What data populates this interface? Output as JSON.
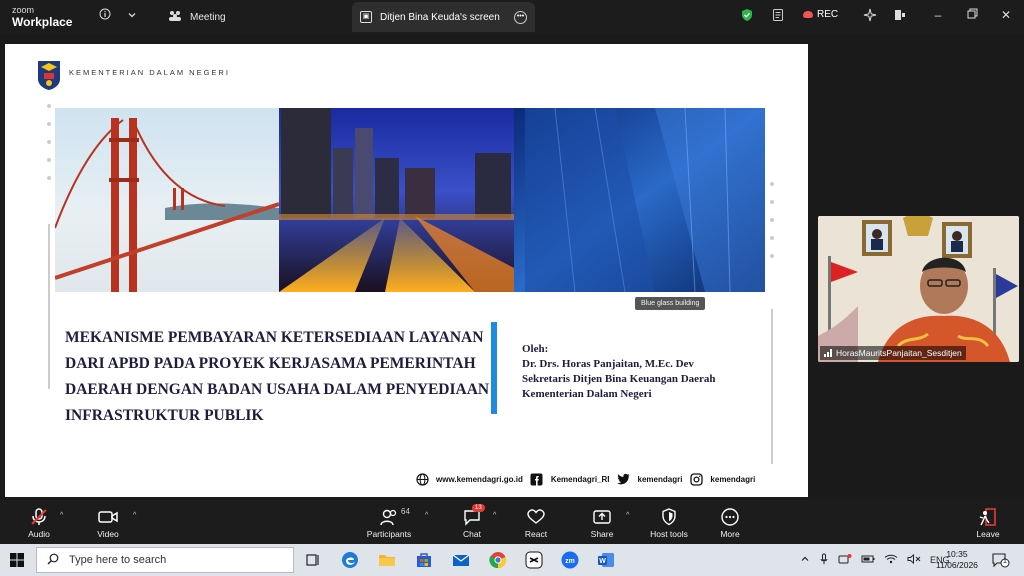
{
  "app": {
    "brand_line1": "zoom",
    "brand_line2": "Workplace",
    "meeting_tab": "Meeting",
    "screen_tab": "Ditjen Bina Keuda's screen",
    "rec_label": "REC"
  },
  "slide": {
    "ministry": "KEMENTERIAN DALAM NEGERI",
    "photo_tooltip": "Blue glass building",
    "title_lines": [
      "MEKANISME PEMBAYARAN KETERSEDIAAN LAYANAN",
      "DARI APBD PADA PROYEK KERJASAMA PEMERINTAH",
      "DAERAH DENGAN BADAN USAHA DALAM PENYEDIAAN",
      "INFRASTRUKTUR PUBLIK"
    ],
    "author_lines": [
      "Oleh:",
      "Dr. Drs. Horas Panjaitan, M.Ec. Dev",
      "Sekretaris Ditjen Bina Keuangan Daerah",
      "Kementerian Dalam Negeri"
    ],
    "social": {
      "web": "www.kemendagri.go.id",
      "facebook": "Kemendagri_RI",
      "twitter": "kemendagri",
      "instagram": "kemendagri"
    },
    "accent_color": "#1e8be0"
  },
  "participant": {
    "name": "HorasMauritsPanjaitan_Sesditjen"
  },
  "toolbar": {
    "audio": "Audio",
    "video": "Video",
    "participants": "Participants",
    "participants_count": "64",
    "chat": "Chat",
    "chat_badge": "13",
    "react": "React",
    "share": "Share",
    "host_tools": "Host tools",
    "more": "More",
    "leave": "Leave"
  },
  "taskbar": {
    "search_placeholder": "Type here to search",
    "language": "ENG",
    "time": "10:35",
    "date": "11/06/2026",
    "notif_count": "1"
  }
}
